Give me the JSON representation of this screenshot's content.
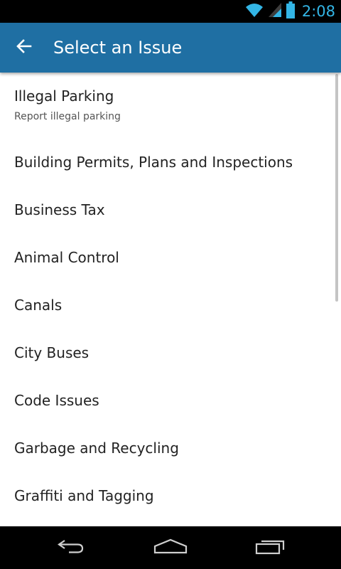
{
  "status_bar": {
    "time": "2:08",
    "icons": [
      "wifi-icon",
      "signal-icon",
      "battery-icon"
    ],
    "accent_color": "#33b5e5"
  },
  "app_bar": {
    "title": "Select an Issue",
    "back_icon": "arrow-left-icon",
    "background_color": "#1f6fa3"
  },
  "issues": [
    {
      "title": "Illegal Parking",
      "subtitle": "Report illegal parking"
    },
    {
      "title": "Building Permits, Plans and Inspections"
    },
    {
      "title": "Business Tax"
    },
    {
      "title": "Animal Control"
    },
    {
      "title": "Canals"
    },
    {
      "title": "City Buses"
    },
    {
      "title": "Code Issues"
    },
    {
      "title": "Garbage and Recycling"
    },
    {
      "title": "Graffiti and Tagging"
    }
  ],
  "nav_bar": {
    "buttons": [
      "back-nav-icon",
      "home-nav-icon",
      "recent-apps-icon"
    ]
  }
}
